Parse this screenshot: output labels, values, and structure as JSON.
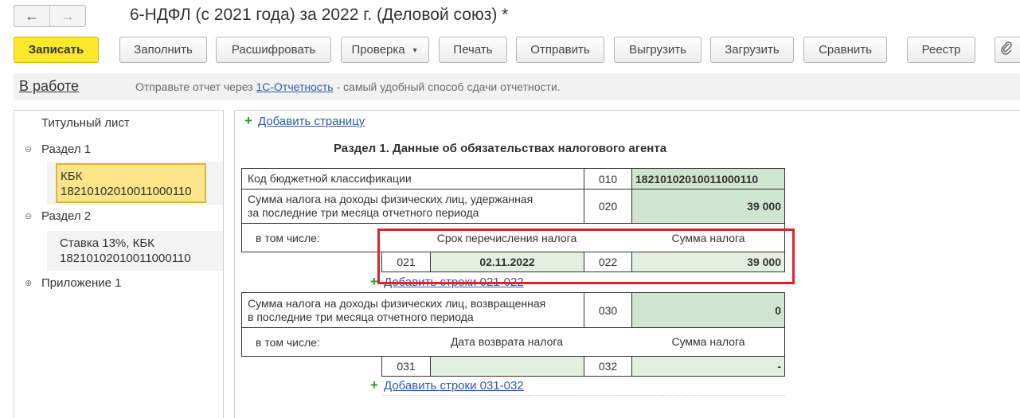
{
  "window": {
    "title": "6-НДФЛ (с 2021 года) за 2022 г. (Деловой союз) *",
    "nav": {
      "back_icon": "←",
      "forward_icon": "→"
    }
  },
  "toolbar": {
    "save": "Записать",
    "fill": "Заполнить",
    "decode": "Расшифровать",
    "check": "Проверка",
    "print": "Печать",
    "send": "Отправить",
    "export": "Выгрузить",
    "import": "Загрузить",
    "compare": "Сравнить",
    "registry": "Реестр",
    "attach_icon": "📎"
  },
  "status": {
    "state": "В работе",
    "msg_before": "Отправьте отчет через ",
    "msg_link": "1С-Отчетность",
    "msg_after": " - самый удобный способ сдачи отчетности."
  },
  "tree": {
    "title_page": "Титульный лист",
    "section1": "Раздел 1",
    "section1_kbk_label": "КБК",
    "section1_kbk_code": "18210102010011000110",
    "section2": "Раздел 2",
    "section2_rate": "Ставка 13%, КБК",
    "section2_kbk_code": "18210102010011000110",
    "appendix1": "Приложение 1",
    "toggle_minus": "⊖",
    "toggle_plus": "⊕"
  },
  "form": {
    "add_page": "Добавить страницу",
    "section_title": "Раздел 1. Данные об обязательствах налогового агента",
    "row010": {
      "label": "Код бюджетной классификации",
      "code": "010",
      "value": "18210102010011000110"
    },
    "row020": {
      "label_line1": "Сумма налога на доходы физических лиц, удержанная",
      "label_line2": "за последние три месяца отчетного периода",
      "code": "020",
      "value": "39 000"
    },
    "incl1": {
      "label": "в том числе:",
      "hdr_date": "Срок перечисления налога",
      "hdr_sum": "Сумма налога",
      "code_date": "021",
      "date": "02.11.2022",
      "code_sum": "022",
      "sum": "39 000",
      "add_link": "Добавить строки 021-022"
    },
    "row030": {
      "label_line1": "Сумма налога на доходы физических лиц, возвращенная",
      "label_line2": "в последние три месяца отчетного периода",
      "code": "030",
      "value": "0"
    },
    "incl2": {
      "label": "в том числе:",
      "hdr_date": "Дата возврата налога",
      "hdr_sum": "Сумма налога",
      "code_date": "031",
      "date": "",
      "code_sum": "032",
      "sum": "-",
      "add_link": "Добавить строки 031-032"
    }
  },
  "colors": {
    "accent_yellow": "#fce72b",
    "field_green": "#cfe5cf",
    "highlight_red": "#e0202a",
    "link_blue": "#2a5ca8"
  }
}
